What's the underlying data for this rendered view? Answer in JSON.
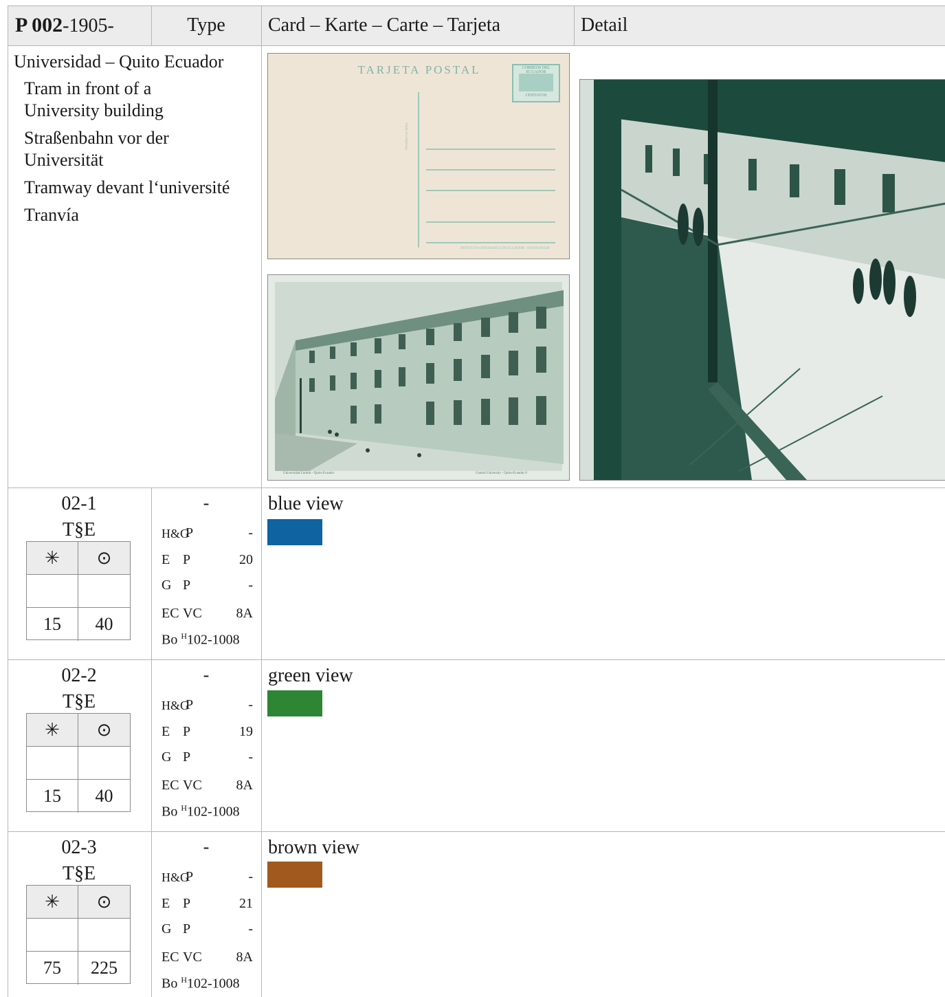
{
  "header": {
    "id_bold": "P 002",
    "id_rest": "-1905-",
    "type": "Type",
    "card": "Card – Karte – Carte – Tarjeta",
    "detail": "Detail"
  },
  "description": {
    "location": "Universidad – Quito Ecuador",
    "en": "Tram in front of a University building",
    "en_1": "Tram in front of a",
    "en_2": "University building",
    "de_1": "Straßenbahn vor der",
    "de_2": "Universität",
    "fr": "Tramway devant l‘université",
    "es": "Tranvía"
  },
  "card_front": {
    "title": "TARJETA POSTAL",
    "stamp_top": "CORREOS DEL ECUADOR",
    "stamp_bottom": "CENTAVOS",
    "printer": "INSTITUTO GEOGRAFICO DE ECUADOR - NUEVA DELHI",
    "vertical_text": "Nombre en letra"
  },
  "card_back": {
    "caption_left": "Universidad Central - Quito-Ecuador",
    "caption_right": "Central University - Quito-Ecuador   8"
  },
  "rows": [
    {
      "code": "02-1",
      "sub": "T§E",
      "grid": {
        "h1": "✳",
        "h2": "⊙",
        "v1": "15",
        "v2": "40"
      },
      "type_dash": "-",
      "hg": "H&G",
      "hg_p": "P",
      "hg_v": "-",
      "e": "E",
      "e_p": "P",
      "e_v": "20",
      "g": "G",
      "g_p": "P",
      "g_v": "-",
      "ec": "EC",
      "ec_p": "VC",
      "ec_v": "8A",
      "bo": "Bo",
      "bo_sup": "H",
      "bo_v": "102-1008",
      "view": "blue view",
      "color": "#0f63a1"
    },
    {
      "code": "02-2",
      "sub": "T§E",
      "grid": {
        "h1": "✳",
        "h2": "⊙",
        "v1": "15",
        "v2": "40"
      },
      "type_dash": "-",
      "hg": "H&G",
      "hg_p": "P",
      "hg_v": "-",
      "e": "E",
      "e_p": "P",
      "e_v": "19",
      "g": "G",
      "g_p": "P",
      "g_v": "-",
      "ec": "EC",
      "ec_p": "VC",
      "ec_v": "8A",
      "bo": "Bo",
      "bo_sup": "H",
      "bo_v": "102-1008",
      "view": "green view",
      "color": "#2e8534"
    },
    {
      "code": "02-3",
      "sub": "T§E",
      "grid": {
        "h1": "✳",
        "h2": "⊙",
        "v1": "75",
        "v2": "225"
      },
      "type_dash": "-",
      "hg": "H&G",
      "hg_p": "P",
      "hg_v": "-",
      "e": "E",
      "e_p": "P",
      "e_v": "21",
      "g": "G",
      "g_p": "P",
      "g_v": "-",
      "ec": "EC",
      "ec_p": "VC",
      "ec_v": "8A",
      "bo": "Bo",
      "bo_sup": "H",
      "bo_v": "102-1008",
      "view": "brown view",
      "color": "#a05a1e"
    }
  ]
}
